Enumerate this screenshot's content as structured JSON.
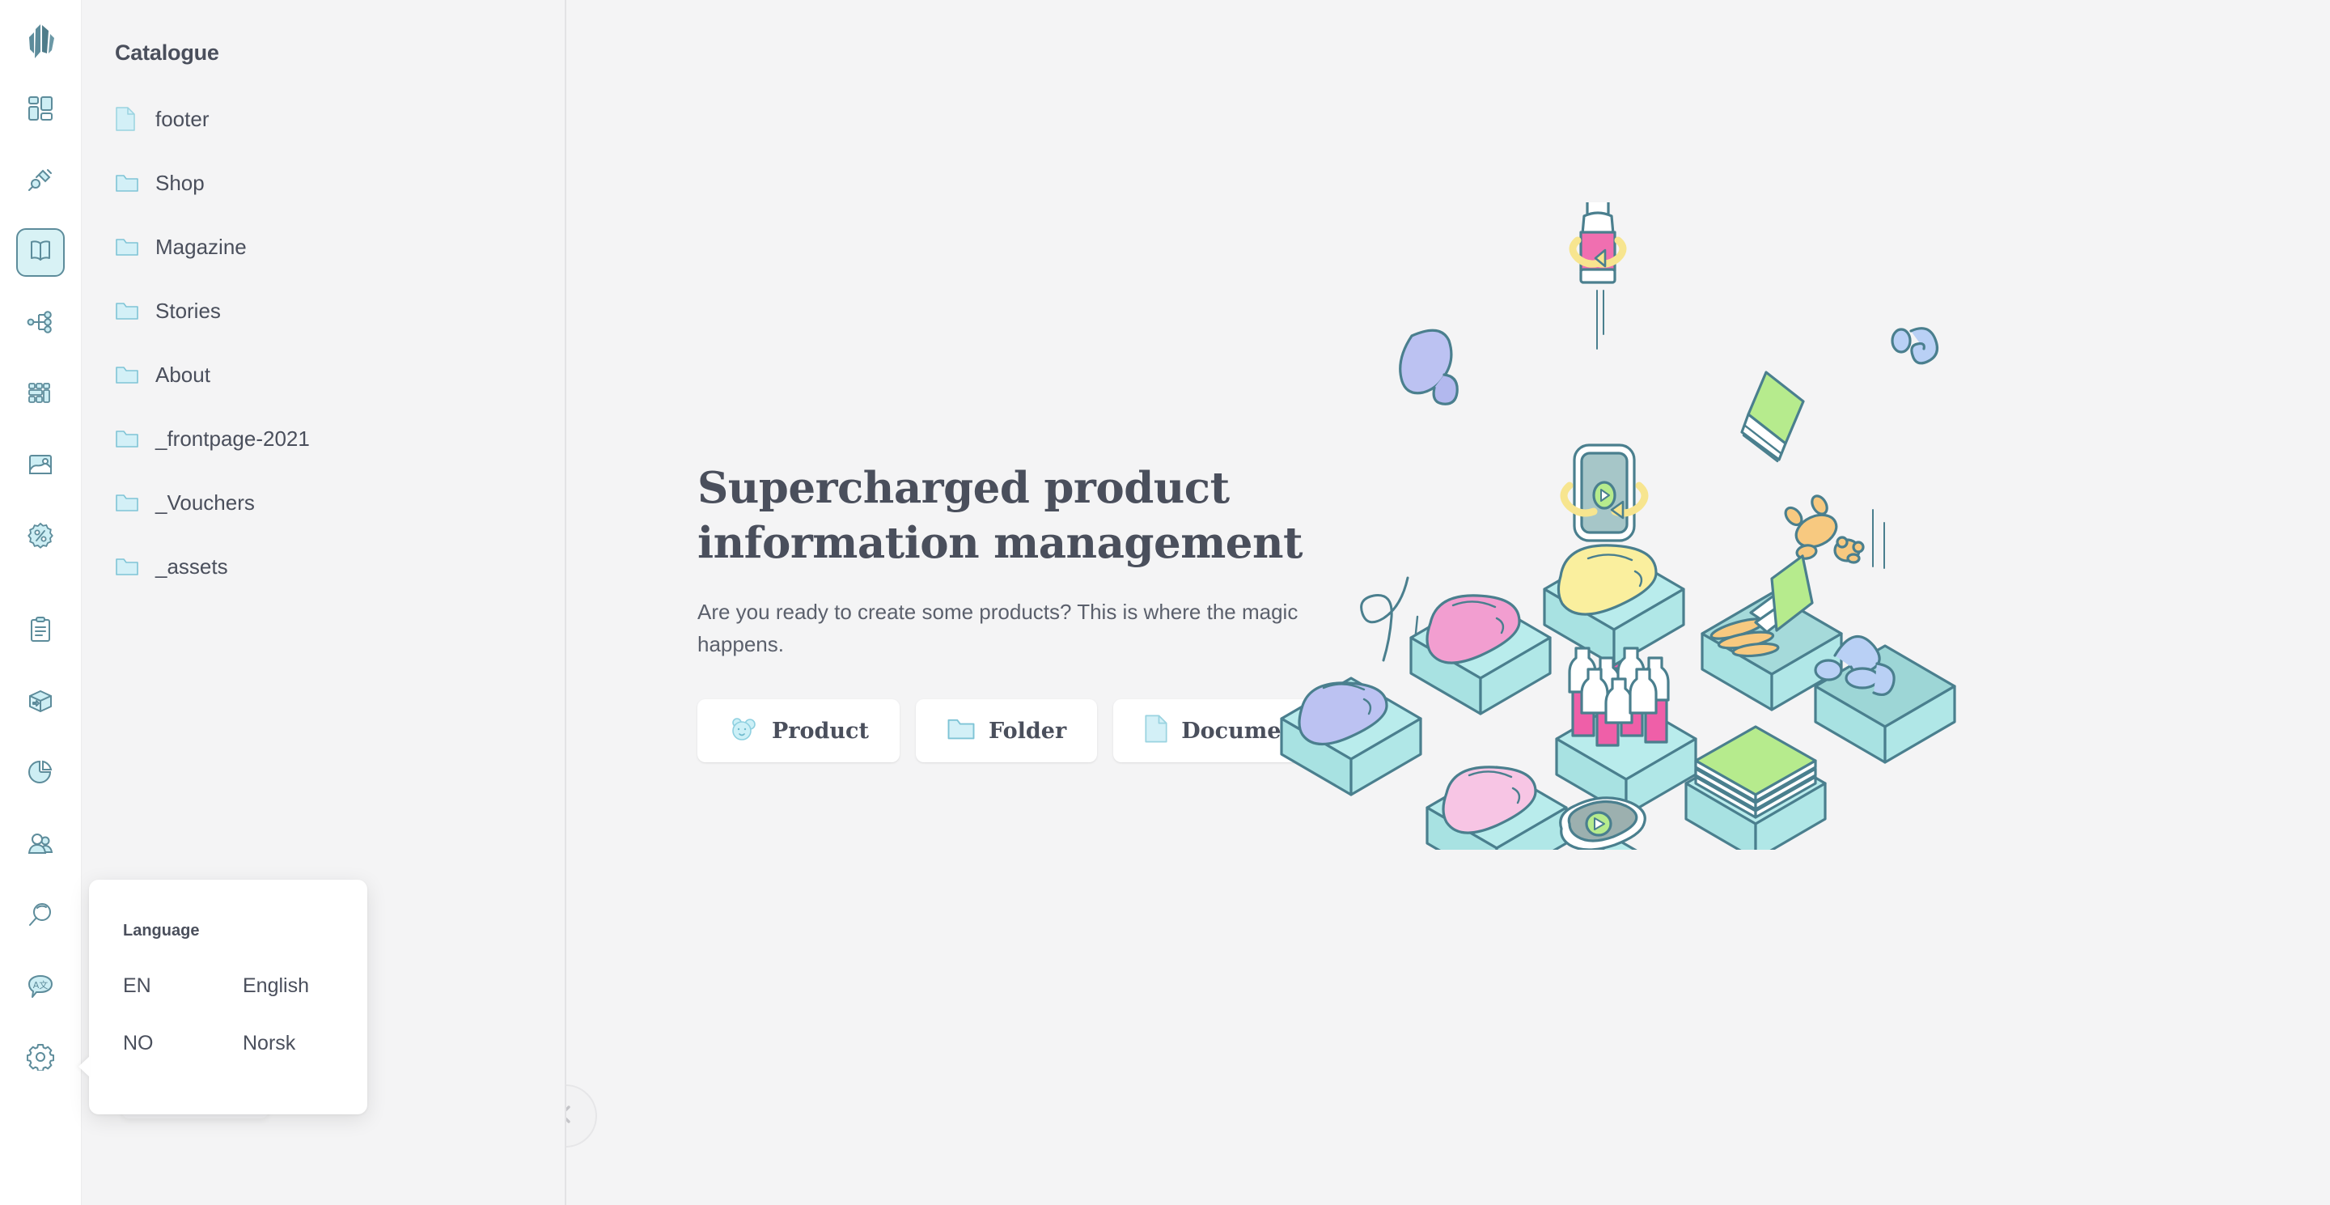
{
  "app": {
    "logo_icon": "crystal-logo-icon",
    "brand_color": "#5d8c9b",
    "accent_fill": "#d8f2f5",
    "background": "#f4f4f5",
    "panel_background": "#ffffff",
    "text_color": "#4a4f5c"
  },
  "rail": {
    "items": [
      {
        "name": "dashboard",
        "icon": "dashboard-grid-icon",
        "active": false
      },
      {
        "name": "integrations",
        "icon": "plug-connector-icon",
        "active": false
      },
      {
        "name": "catalogue",
        "icon": "open-book-icon",
        "active": true
      },
      {
        "name": "taxonomy",
        "icon": "node-tree-icon",
        "active": false
      },
      {
        "name": "layouts",
        "icon": "blocks-layout-icon",
        "active": false
      },
      {
        "name": "media",
        "icon": "image-picture-icon",
        "active": false
      },
      {
        "name": "discounts",
        "icon": "percent-badge-icon",
        "active": false
      },
      {
        "name": "orders",
        "icon": "clipboard-list-icon",
        "active": false
      },
      {
        "name": "shipping",
        "icon": "package-box-icon",
        "active": false
      },
      {
        "name": "analytics",
        "icon": "pie-chart-icon",
        "active": false
      },
      {
        "name": "customers",
        "icon": "users-group-icon",
        "active": false
      },
      {
        "name": "search",
        "icon": "magnifier-icon",
        "active": false
      },
      {
        "name": "translations",
        "icon": "translate-bubble-icon",
        "active": false
      },
      {
        "name": "settings",
        "icon": "gear-icon",
        "active": false
      }
    ]
  },
  "catalogue": {
    "title": "Catalogue",
    "items": [
      {
        "label": "footer",
        "type": "document",
        "icon": "document-icon"
      },
      {
        "label": "Shop",
        "type": "folder",
        "icon": "folder-icon"
      },
      {
        "label": "Magazine",
        "type": "folder",
        "icon": "folder-icon"
      },
      {
        "label": "Stories",
        "type": "folder",
        "icon": "folder-icon"
      },
      {
        "label": "About",
        "type": "folder",
        "icon": "folder-icon"
      },
      {
        "label": "_frontpage-2021",
        "type": "folder",
        "icon": "folder-icon"
      },
      {
        "label": "_Vouchers",
        "type": "folder",
        "icon": "folder-icon"
      },
      {
        "label": "_assets",
        "type": "folder",
        "icon": "folder-icon"
      }
    ],
    "collapse_icon": "chevron-left-icon"
  },
  "language_popup": {
    "title": "Language",
    "options": [
      {
        "code": "EN",
        "name": "English"
      },
      {
        "code": "NO",
        "name": "Norsk"
      }
    ]
  },
  "hero": {
    "title_line_1": "Supercharged product",
    "title_line_2": "information management",
    "subtitle": "Are you ready to create some products? This is where the magic happens.",
    "actions": [
      {
        "label": "Product",
        "icon": "teddy-bear-icon"
      },
      {
        "label": "Folder",
        "icon": "folder-icon"
      },
      {
        "label": "Document",
        "icon": "document-icon"
      }
    ]
  },
  "illustration": {
    "name": "isometric-product-boxes-illustration",
    "description": "Assorted products falling into pastel isometric crates"
  }
}
